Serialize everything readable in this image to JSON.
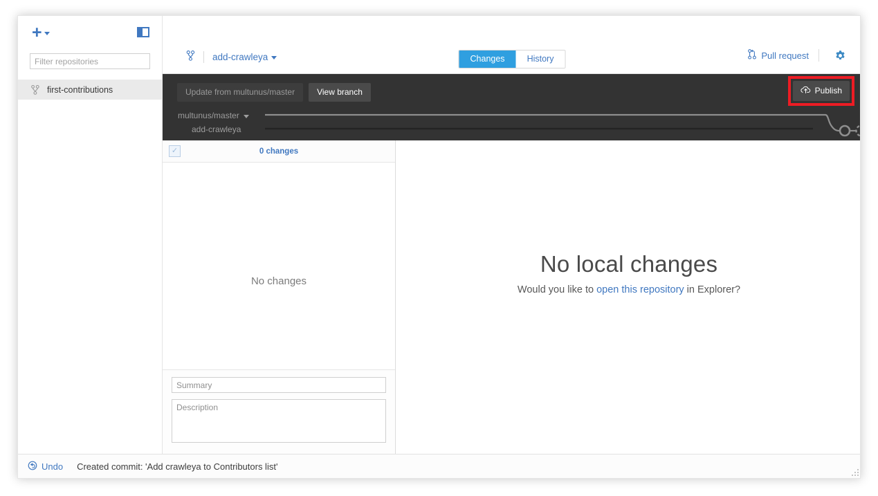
{
  "window": {
    "controls": {
      "minimize": "minimize-icon",
      "maximize": "maximize-icon",
      "close": "close-icon"
    }
  },
  "sidebar": {
    "add_button": {
      "icon": "plus-icon",
      "caret": "chevron-down-icon"
    },
    "panel_toggle_icon": "sidebar-toggle-icon",
    "filter": {
      "placeholder": "Filter repositories",
      "value": ""
    },
    "repositories": [
      {
        "name": "first-contributions",
        "icon": "git-branch-icon",
        "selected": true
      }
    ]
  },
  "header": {
    "repo_icon": "git-branch-icon",
    "branch": "add-crawleya",
    "branch_caret": "chevron-down-icon",
    "tabs": [
      {
        "label": "Changes",
        "active": true
      },
      {
        "label": "History",
        "active": false
      }
    ],
    "pull_request": {
      "label": "Pull request",
      "icon": "pull-request-icon"
    },
    "settings_icon": "gear-icon"
  },
  "toolbar": {
    "update_button": {
      "label": "Update from multunus/master",
      "enabled": false
    },
    "view_branch_button": {
      "label": "View branch",
      "enabled": true
    },
    "publish_button": {
      "label": "Publish",
      "icon": "cloud-upload-icon"
    },
    "highlight_color": "#ed1c24",
    "graph": {
      "upstream_branch": "multunus/master",
      "upstream_caret": "chevron-down-icon",
      "local_branch": "add-crawleya"
    }
  },
  "changes_panel": {
    "select_all_checkbox": {
      "checked": true
    },
    "count_label": "0 changes",
    "empty_text": "No changes",
    "summary": {
      "placeholder": "Summary",
      "value": ""
    },
    "description": {
      "placeholder": "Description",
      "value": ""
    }
  },
  "main_panel": {
    "title": "No local changes",
    "subtitle_before": "Would you like to ",
    "subtitle_link": "open this repository",
    "subtitle_after": " in Explorer?"
  },
  "statusbar": {
    "undo_label": "Undo",
    "undo_icon": "undo-icon",
    "message": "Created commit: 'Add crawleya to Contributors list'"
  },
  "colors": {
    "accent_blue": "#4078c0",
    "tab_active": "#2f9fe0",
    "dark_toolbar": "#333333",
    "highlight_red": "#ed1c24"
  }
}
